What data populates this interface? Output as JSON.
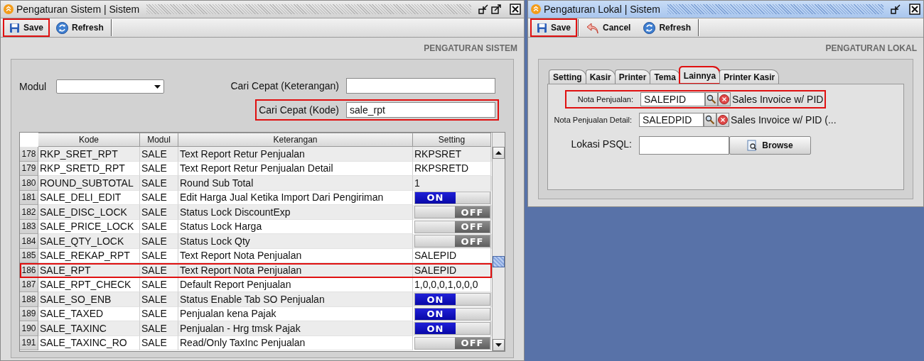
{
  "left_window": {
    "title": "Pengaturan Sistem | Sistem",
    "active": false,
    "toolbar": [
      {
        "kind": "save",
        "label": "Save",
        "highlighted": true
      },
      {
        "kind": "refresh",
        "label": "Refresh",
        "highlighted": false
      }
    ],
    "heading": "PENGATURAN SISTEM",
    "modul_label": "Modul",
    "search_fields": [
      {
        "label": "Cari Cepat (Keterangan)",
        "highlighted": false
      },
      {
        "label": "Cari Cepat (Kode)",
        "value": "sale_rpt",
        "highlighted": true
      }
    ],
    "table": {
      "columns": [
        "Kode",
        "Modul",
        "Keterangan",
        "Setting"
      ],
      "rows": [
        {
          "number": "178",
          "kode": "RKP_SRET_RPT",
          "modul": "SALE",
          "keterangan": "Text Report Retur Penjualan",
          "setting": {
            "kind": "text",
            "text": "RKPSRET"
          },
          "highlighted": false
        },
        {
          "number": "179",
          "kode": "RKP_SRETD_RPT",
          "modul": "SALE",
          "keterangan": "Text Report Retur Penjualan Detail",
          "setting": {
            "kind": "text",
            "text": "RKPSRETD"
          },
          "highlighted": false
        },
        {
          "number": "180",
          "kode": "ROUND_SUBTOTAL",
          "modul": "SALE",
          "keterangan": "Round Sub Total",
          "setting": {
            "kind": "text",
            "text": "1"
          },
          "highlighted": false
        },
        {
          "number": "181",
          "kode": "SALE_DELI_EDIT",
          "modul": "SALE",
          "keterangan": "Edit Harga Jual Ketika Import Dari Pengiriman",
          "setting": {
            "kind": "toggle",
            "label": "ON",
            "on": true
          },
          "highlighted": false
        },
        {
          "number": "182",
          "kode": "SALE_DISC_LOCK",
          "modul": "SALE",
          "keterangan": "Status Lock DiscountExp",
          "setting": {
            "kind": "toggle",
            "label": "OFF",
            "on": false
          },
          "highlighted": false
        },
        {
          "number": "183",
          "kode": "SALE_PRICE_LOCK",
          "modul": "SALE",
          "keterangan": "Status Lock Harga",
          "setting": {
            "kind": "toggle",
            "label": "OFF",
            "on": false
          },
          "highlighted": false
        },
        {
          "number": "184",
          "kode": "SALE_QTY_LOCK",
          "modul": "SALE",
          "keterangan": "Status Lock Qty",
          "setting": {
            "kind": "toggle",
            "label": "OFF",
            "on": false
          },
          "highlighted": false
        },
        {
          "number": "185",
          "kode": "SALE_REKAP_RPT",
          "modul": "SALE",
          "keterangan": "Text Report Nota Penjualan",
          "setting": {
            "kind": "text",
            "text": "SALEPID"
          },
          "highlighted": false
        },
        {
          "number": "186",
          "kode": "SALE_RPT",
          "modul": "SALE",
          "keterangan": "Text Report Nota Penjualan",
          "setting": {
            "kind": "text",
            "text": "SALEPID"
          },
          "highlighted": true
        },
        {
          "number": "187",
          "kode": "SALE_RPT_CHECK",
          "modul": "SALE",
          "keterangan": "Default Report Penjualan",
          "setting": {
            "kind": "text",
            "text": "1,0,0,0,1,0,0,0"
          },
          "highlighted": false
        },
        {
          "number": "188",
          "kode": "SALE_SO_ENB",
          "modul": "SALE",
          "keterangan": "Status Enable Tab SO Penjualan",
          "setting": {
            "kind": "toggle",
            "label": "ON",
            "on": true
          },
          "highlighted": false
        },
        {
          "number": "189",
          "kode": "SALE_TAXED",
          "modul": "SALE",
          "keterangan": "Penjualan kena Pajak",
          "setting": {
            "kind": "toggle",
            "label": "ON",
            "on": true
          },
          "highlighted": false
        },
        {
          "number": "190",
          "kode": "SALE_TAXINC",
          "modul": "SALE",
          "keterangan": "Penjualan - Hrg tmsk Pajak",
          "setting": {
            "kind": "toggle",
            "label": "ON",
            "on": true
          },
          "highlighted": false
        },
        {
          "number": "191",
          "kode": "SALE_TAXINC_RO",
          "modul": "SALE",
          "keterangan": "Read/Only TaxInc Penjualan",
          "setting": {
            "kind": "toggle",
            "label": "OFF",
            "on": false
          },
          "highlighted": false
        }
      ]
    }
  },
  "right_window": {
    "title": "Pengaturan Lokal | Sistem",
    "active": true,
    "toolbar": [
      {
        "kind": "save",
        "label": "Save",
        "highlighted": true
      },
      {
        "kind": "cancel",
        "label": "Cancel",
        "highlighted": false
      },
      {
        "kind": "refresh",
        "label": "Refresh",
        "highlighted": false
      }
    ],
    "heading": "PENGATURAN LOKAL",
    "tabs": [
      {
        "label": "Setting",
        "selected": false,
        "highlighted": false
      },
      {
        "label": "Kasir",
        "selected": false,
        "highlighted": false
      },
      {
        "label": "Printer",
        "selected": false,
        "highlighted": false
      },
      {
        "label": "Tema",
        "selected": false,
        "highlighted": false
      },
      {
        "label": "Lainnya",
        "selected": true,
        "highlighted": true
      },
      {
        "label": "Printer Kasir",
        "selected": false,
        "highlighted": false
      }
    ],
    "fields": [
      {
        "kind": "lookup",
        "label": "Nota Penjualan:",
        "value": "SALEPID",
        "description": "Sales Invoice w/ PID",
        "highlighted": true
      },
      {
        "kind": "lookup",
        "label": "Nota Penjualan Detail:",
        "value": "SALEDPID",
        "description": "Sales Invoice w/ PID (...",
        "highlighted": false
      },
      {
        "kind": "path",
        "label": "Lokasi PSQL:",
        "button": "Browse",
        "highlighted": false
      }
    ]
  }
}
